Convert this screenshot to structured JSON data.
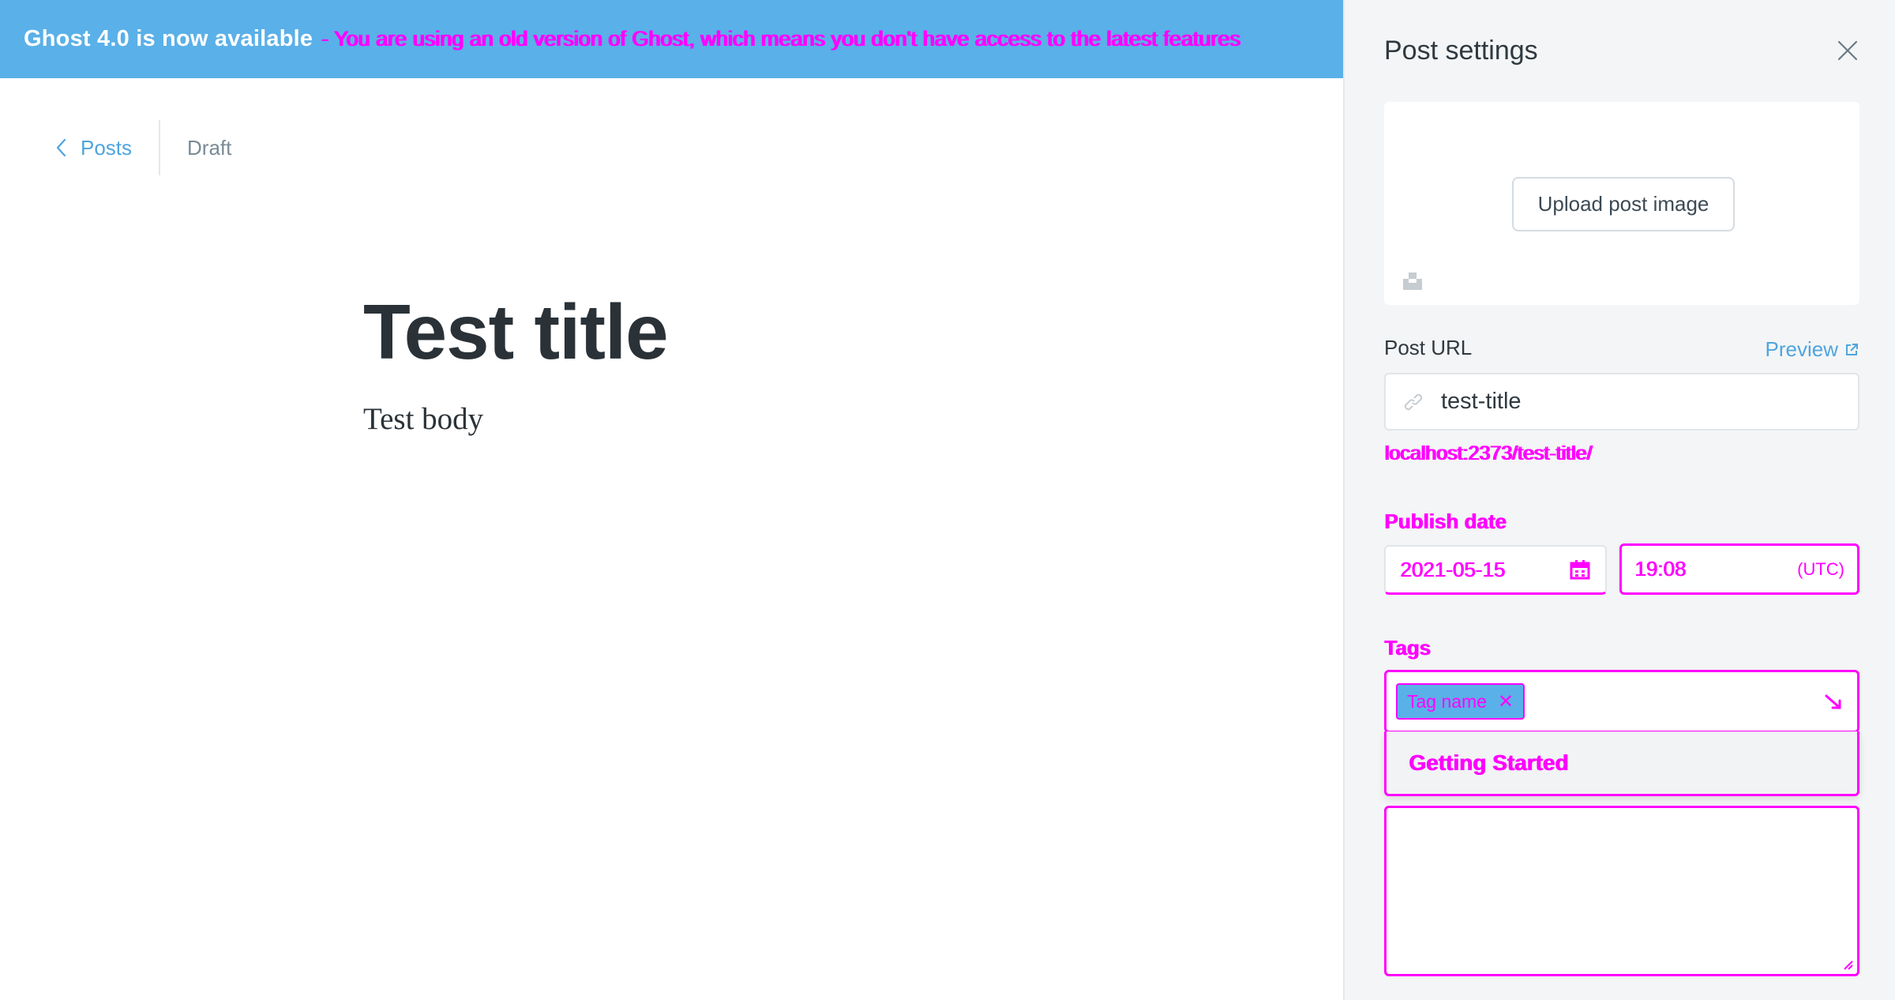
{
  "banner": {
    "title": "Ghost 4.0 is now available",
    "message": "- You are using an old version of Ghost, which means you don't have access to the latest features"
  },
  "breadcrumb": {
    "back_label": "Posts",
    "status": "Draft"
  },
  "editor": {
    "title": "Test title",
    "body": "Test body"
  },
  "settings": {
    "title": "Post settings",
    "upload_label": "Upload post image",
    "url_label": "Post URL",
    "preview_label": "Preview",
    "slug": "test-title",
    "url_hint": "localhost:2373/test-title/",
    "publish_label": "Publish date",
    "date": "2021-05-15",
    "time": "19:08",
    "timezone": "(UTC)",
    "tags_label": "Tags",
    "tags": [
      "Tag name"
    ],
    "suggestion": "Getting Started"
  },
  "colors": {
    "accent": "#5ab0e8",
    "highlight": "#ff00ff"
  }
}
